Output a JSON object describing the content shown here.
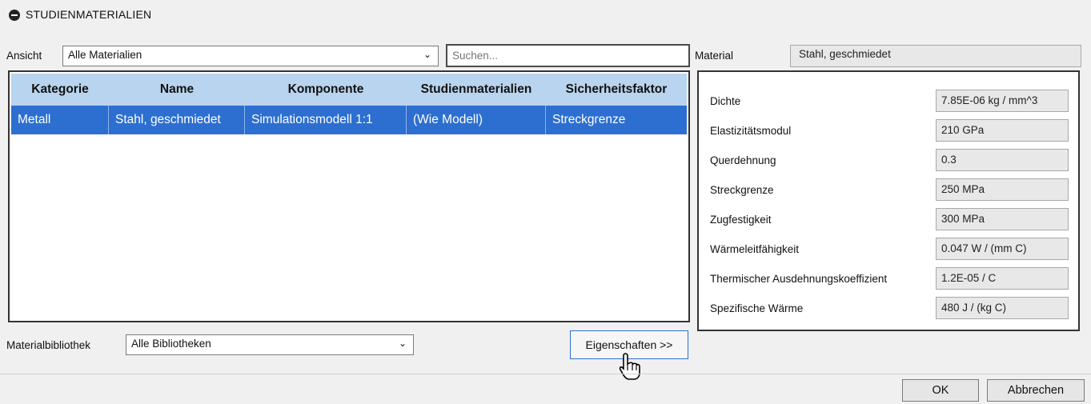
{
  "header": {
    "title": "STUDIENMATERIALIEN",
    "collapse_icon": "collapse-minus-icon"
  },
  "view": {
    "label": "Ansicht",
    "selected": "Alle Materialien",
    "search_placeholder": "Suchen..."
  },
  "material": {
    "label": "Material",
    "value": "Stahl, geschmiedet"
  },
  "table": {
    "columns": [
      "Kategorie",
      "Name",
      "Komponente",
      "Studienmaterialien",
      "Sicherheitsfaktor"
    ],
    "rows": [
      [
        "Metall",
        "Stahl, geschmiedet",
        "Simulationsmodell 1:1",
        "(Wie Modell)",
        "Streckgrenze"
      ]
    ]
  },
  "properties": [
    {
      "label": "Dichte",
      "value": "7.85E-06 kg / mm^3"
    },
    {
      "label": "Elastizitätsmodul",
      "value": "210 GPa"
    },
    {
      "label": "Querdehnung",
      "value": "0.3"
    },
    {
      "label": "Streckgrenze",
      "value": "250 MPa"
    },
    {
      "label": "Zugfestigkeit",
      "value": "300 MPa"
    },
    {
      "label": "Wärmeleitfähigkeit",
      "value": "0.047 W / (mm C)"
    },
    {
      "label": "Thermischer Ausdehnungskoeffizient",
      "value": "1.2E-05 / C"
    },
    {
      "label": "Spezifische Wärme",
      "value": "480 J / (kg C)"
    }
  ],
  "library": {
    "label": "Materialbibliothek",
    "selected": "Alle Bibliotheken"
  },
  "buttons": {
    "properties": "Eigenschaften >>",
    "ok": "OK",
    "cancel": "Abbrechen"
  },
  "colors": {
    "selection": "#2d6fd0",
    "header_bg": "#b8d4ee"
  }
}
